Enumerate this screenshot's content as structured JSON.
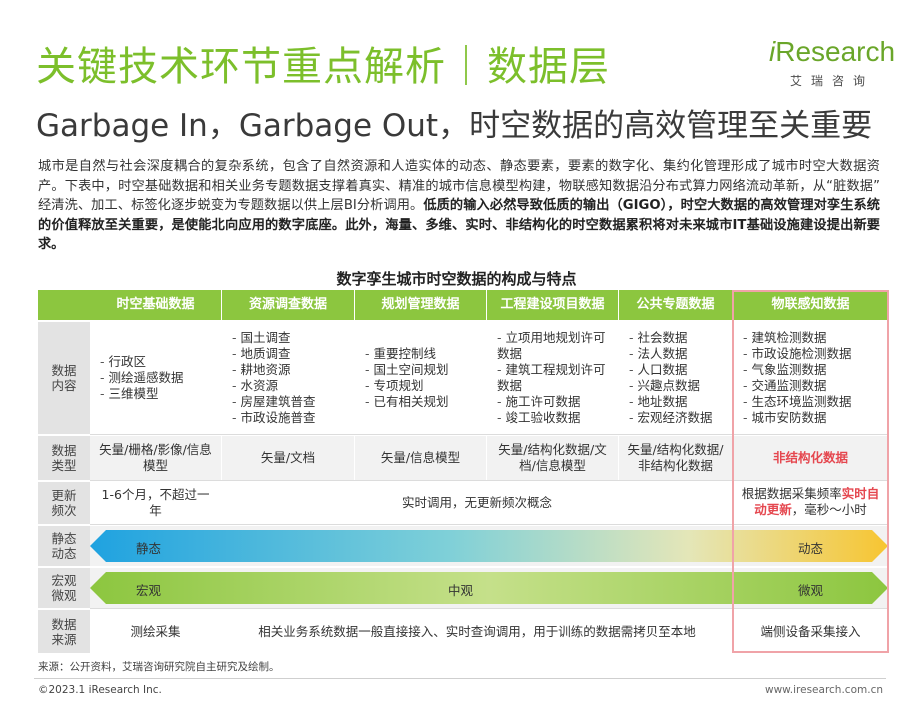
{
  "header": {
    "title": "关键技术环节重点解析｜数据层",
    "subtitle": "Garbage In，Garbage Out，时空数据的高效管理至关重要"
  },
  "logo": {
    "word_i": "i",
    "word_rest": "Research",
    "cn": "艾瑞咨询"
  },
  "intro": {
    "normal": "城市是自然与社会深度耦合的复杂系统，包含了自然资源和人造实体的动态、静态要素，要素的数字化、集约化管理形成了城市时空大数据资产。下表中，时空基础数据和相关业务专题数据支撑着真实、精准的城市信息模型构建，物联感知数据沿分布式算力网络流动革新，从“脏数据” 经清洗、加工、标签化逐步蜕变为专题数据以供上层BI分析调用。",
    "bold": "低质的输入必然导致低质的输出（GIGO），时空大数据的高效管理对孪生系统的价值释放至关重要，是使能北向应用的数字底座。此外，海量、多维、实时、非结构化的时空数据累积将对未来城市IT基础设施建设提出新要求。"
  },
  "table": {
    "title": "数字孪生城市时空数据的构成与特点",
    "columns": [
      "时空基础数据",
      "资源调查数据",
      "规划管理数据",
      "工程建设项目数据",
      "公共专题数据",
      "物联感知数据"
    ],
    "row_labels": {
      "content": "数据内容",
      "type": "数据类型",
      "update": "更新频次",
      "static_dynamic": "静态动态",
      "scale": "宏观微观",
      "source": "数据来源"
    },
    "content": [
      [
        "行政区",
        "测绘遥感数据",
        "三维模型"
      ],
      [
        "国土调查",
        "地质调查",
        "耕地资源",
        "水资源",
        "房屋建筑普查",
        "市政设施普查"
      ],
      [
        "重要控制线",
        "国土空间规划",
        "专项规划",
        "已有相关规划"
      ],
      [
        "立项用地规划许可数据",
        "建筑工程规划许可数据",
        "施工许可数据",
        "竣工验收数据"
      ],
      [
        "社会数据",
        "法人数据",
        "人口数据",
        "兴趣点数据",
        "地址数据",
        "宏观经济数据"
      ],
      [
        "建筑检测数据",
        "市政设施检测数据",
        "气象监测数据",
        "交通监测数据",
        "生态环境监测数据",
        "城市安防数据"
      ]
    ],
    "types": [
      "矢量/栅格/影像/信息模型",
      "矢量/文档",
      "矢量/信息模型",
      "矢量/结构化数据/文档/信息模型",
      "矢量/结构化数据/非结构化数据",
      "非结构化数据"
    ],
    "update": {
      "first": "1-6个月，不超过一年",
      "middle": "实时调用，无更新频次概念",
      "last_pre": "根据数据采集频率",
      "last_red": "实时自动更新",
      "last_post": "，毫秒～小时"
    },
    "static_dynamic": {
      "left": "静态",
      "right": "动态"
    },
    "scale": {
      "left": "宏观",
      "middle": "中观",
      "right": "微观"
    },
    "sources": {
      "first": "测绘采集",
      "middle": "相关业务系统数据一般直接接入、实时查询调用，用于训练的数据需拷贝至本地",
      "last": "端侧设备采集接入"
    }
  },
  "footer": {
    "source": "来源：公开资料，艾瑞咨询研究院自主研究及绘制。",
    "copyright": "©2023.1 iResearch Inc.",
    "site": "www.iresearch.com.cn"
  },
  "colors": {
    "green": "#8cc63f",
    "title_green": "#7cbf2b",
    "highlight_red": "#e5474f",
    "blue_arrow": "#29a8e0",
    "yellow_arrow": "#f7c531"
  }
}
